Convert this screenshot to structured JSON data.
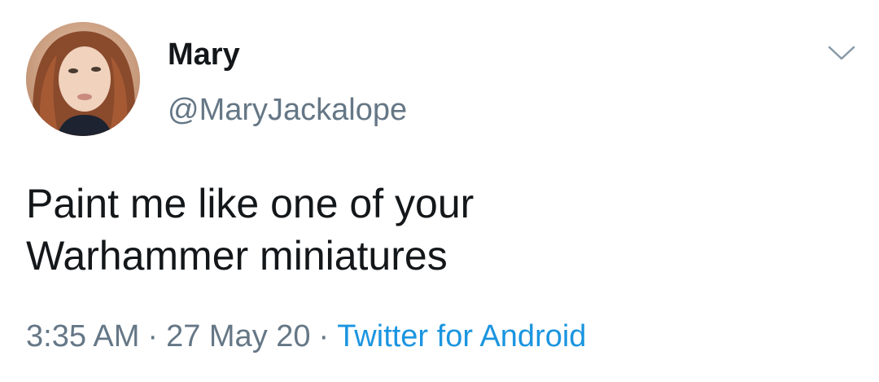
{
  "user": {
    "display_name": "Mary",
    "handle": "@MaryJackalope",
    "avatar_icon": "profile-photo"
  },
  "menu": {
    "icon": "chevron-down-icon"
  },
  "tweet": {
    "lines": [
      "Paint me like one of your",
      "Warhammer miniatures"
    ]
  },
  "meta": {
    "time": "3:35 AM",
    "separator": "·",
    "date": "27 May 20",
    "source": "Twitter for Android"
  },
  "colors": {
    "text": "#14171a",
    "secondary": "#657786",
    "link": "#1b95e0"
  }
}
